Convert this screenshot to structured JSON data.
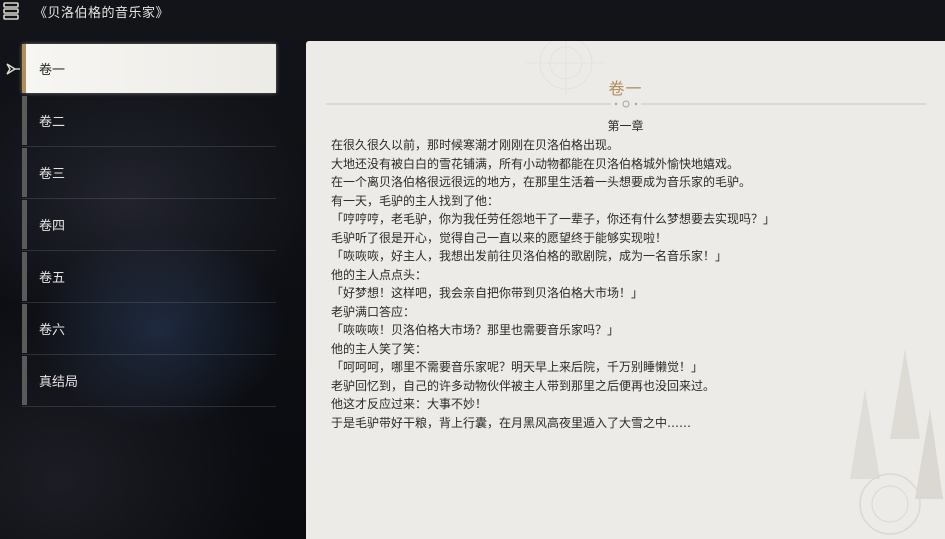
{
  "window": {
    "title": "《贝洛伯格的音乐家》"
  },
  "sidebar": {
    "items": [
      {
        "label": "卷一",
        "active": true
      },
      {
        "label": "卷二"
      },
      {
        "label": "卷三"
      },
      {
        "label": "卷四"
      },
      {
        "label": "卷五"
      },
      {
        "label": "卷六"
      },
      {
        "label": "真结局"
      }
    ]
  },
  "content": {
    "title": "卷一",
    "section": "第一章",
    "lines": [
      "在很久很久以前，那时候寒潮才刚刚在贝洛伯格出现。",
      "大地还没有被白白的雪花铺满，所有小动物都能在贝洛伯格城外愉快地嬉戏。",
      "在一个离贝洛伯格很远很远的地方，在那里生活着一头想要成为音乐家的毛驴。",
      "有一天，毛驴的主人找到了他：",
      "「哼哼哼，老毛驴，你为我任劳任怨地干了一辈子，你还有什么梦想要去实现吗？」",
      "毛驴听了很是开心，觉得自己一直以来的愿望终于能够实现啦！",
      "「咴咴咴，好主人，我想出发前往贝洛伯格的歌剧院，成为一名音乐家！」",
      "他的主人点点头：",
      "「好梦想！这样吧，我会亲自把你带到贝洛伯格大市场！」",
      "老驴满口答应：",
      "「咴咴咴！贝洛伯格大市场？那里也需要音乐家吗？」",
      "他的主人笑了笑：",
      "「呵呵呵，哪里不需要音乐家呢？明天早上来后院，千万别睡懒觉！」",
      "老驴回忆到，自己的许多动物伙伴被主人带到那里之后便再也没回来过。",
      "他这才反应过来：大事不妙！",
      "于是毛驴带好干粮，背上行囊，在月黑风高夜里遁入了大雪之中……"
    ]
  },
  "colors": {
    "accent": "#b08e5c",
    "panel_bg": "#ecebe7",
    "text": "#2b2b2b"
  }
}
